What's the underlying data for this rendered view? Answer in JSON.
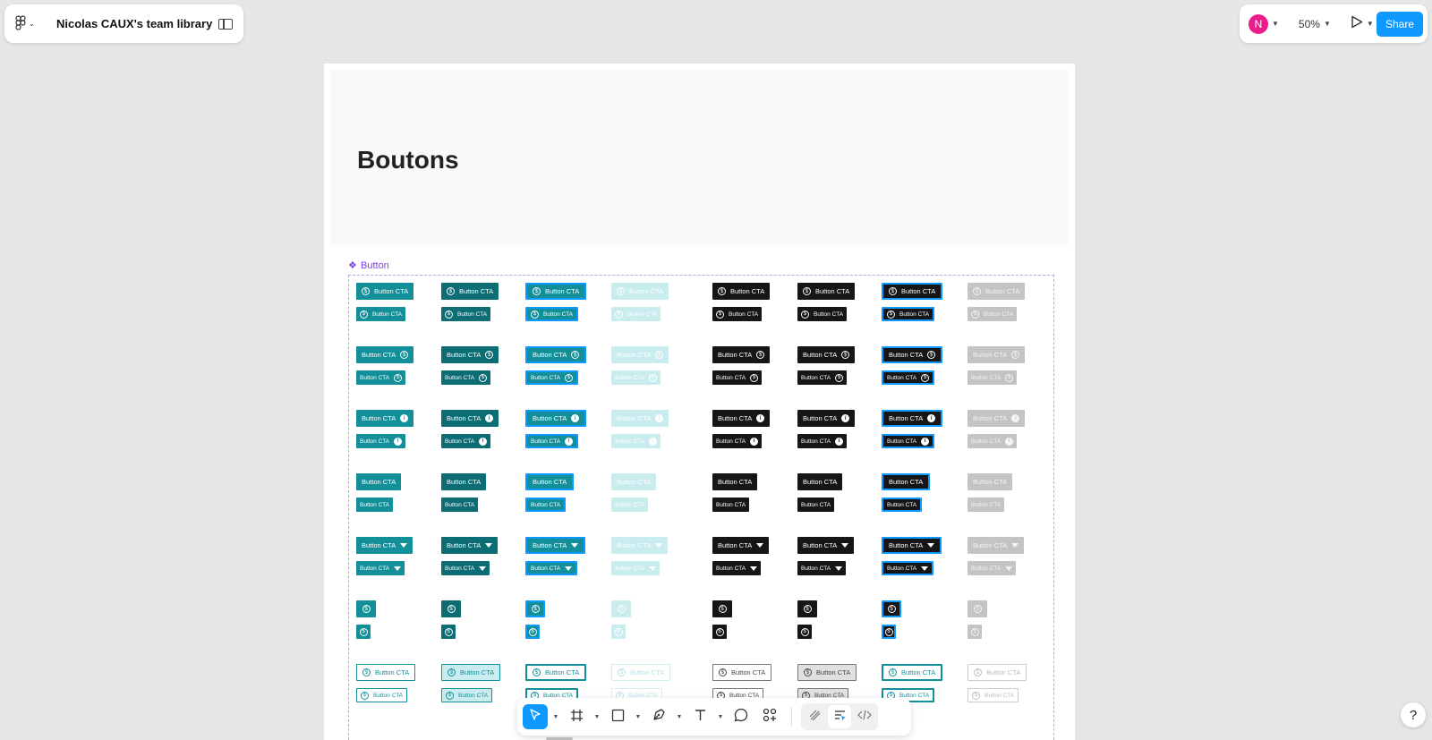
{
  "app": {
    "team_name": "Nicolas CAUX's team library",
    "user_initial": "N",
    "zoom": "50%",
    "share_label": "Share",
    "help_label": "?"
  },
  "canvas": {
    "page_title": "Boutons",
    "component_name": "Button",
    "button_label": "Button CTA"
  },
  "colors": {
    "teal": "#138f99",
    "teal_dark": "#0c6d75",
    "teal_light": "#c9ecef",
    "black": "#161616",
    "disabled": "#c4c4c4",
    "select_blue": "#0d99ff",
    "brand_purple": "#7b42e8"
  },
  "toolbar": {
    "tools": [
      "move-icon",
      "frame-icon",
      "rectangle-icon",
      "pen-icon",
      "text-icon",
      "comment-icon",
      "components-icon"
    ],
    "modes": [
      "draw-icon",
      "design-icon",
      "dev-mode-icon"
    ]
  }
}
